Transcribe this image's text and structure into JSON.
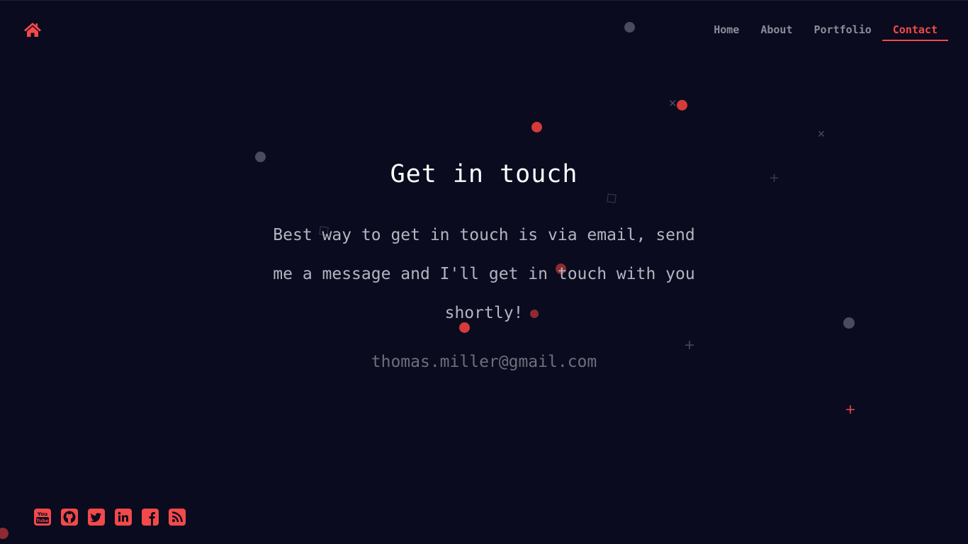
{
  "nav": {
    "home_icon": "home-icon",
    "items": [
      {
        "label": "Home",
        "active": false
      },
      {
        "label": "About",
        "active": false
      },
      {
        "label": "Portfolio",
        "active": false
      },
      {
        "label": "Contact",
        "active": true
      }
    ]
  },
  "main": {
    "title": "Get in touch",
    "description": "Best way to get in touch is via email, send me a message and I'll get in touch with you shortly!",
    "email": "thomas.miller@gmail.com"
  },
  "socials": [
    {
      "name": "youtube-icon"
    },
    {
      "name": "github-icon"
    },
    {
      "name": "twitter-icon"
    },
    {
      "name": "linkedin-icon"
    },
    {
      "name": "facebook-icon"
    },
    {
      "name": "rss-icon"
    }
  ],
  "colors": {
    "background": "#0a0b1e",
    "accent": "#f2494a",
    "nav_text": "#8b8c99",
    "title": "#ffffff",
    "body_text": "#b4b5c0",
    "email": "#6e6f7c"
  }
}
